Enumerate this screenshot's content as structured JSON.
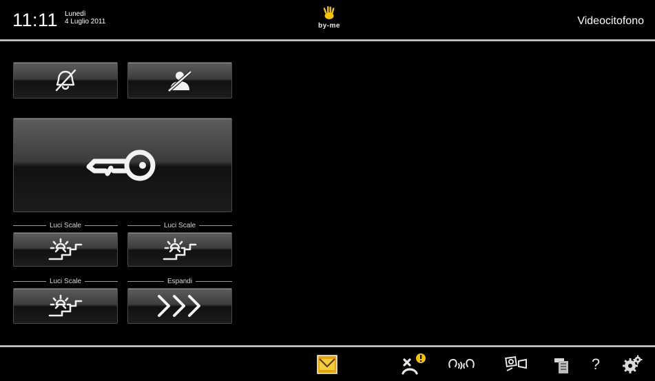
{
  "header": {
    "time": "11:11",
    "day": "Lunedì",
    "date": "4 Luglio 2011",
    "logo_text": "by-me",
    "section_title": "Videocitofono"
  },
  "controls": {
    "mute_ringer_icon": "bell-off-icon",
    "privacy_icon": "person-off-icon",
    "door_open_icon": "key-icon",
    "stair_lights_icon": "stair-light-icon",
    "expand_icon": "triple-chevron-right-icon",
    "labels": {
      "lights_1": "Luci Scale",
      "lights_2": "Luci Scale",
      "lights_3": "Luci Scale",
      "expand": "Espandi"
    }
  },
  "bottombar": {
    "items": [
      {
        "name": "messages-envelope-icon",
        "active": true
      },
      {
        "name": "missed-call-alert-icon"
      },
      {
        "name": "intercom-icon"
      },
      {
        "name": "camera-cycle-icon"
      },
      {
        "name": "address-book-icon"
      },
      {
        "name": "help-icon",
        "glyph": "?"
      },
      {
        "name": "settings-gears-icon"
      }
    ]
  },
  "colors": {
    "background": "#000000",
    "logo_yellow": "#f5c400",
    "alert_yellow": "#f5c400",
    "active_orange": "#e8a400"
  }
}
